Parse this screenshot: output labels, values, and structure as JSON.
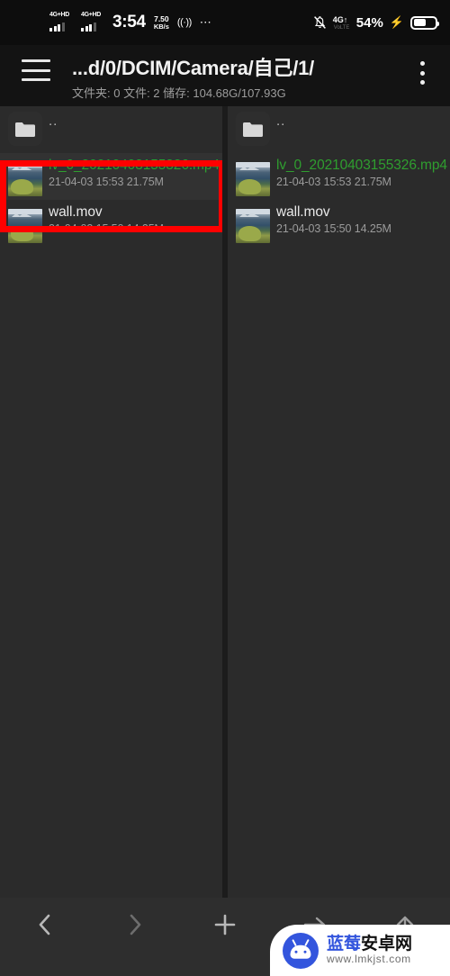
{
  "status_bar": {
    "sim1_network": "4G+HD",
    "sim2_network": "4G+HD",
    "time": "3:54",
    "speed_value": "7.50",
    "speed_unit": "KB/s",
    "hotspot_icon": "hotspot-icon",
    "more_icon": "more-dots-icon",
    "mute_icon": "bell-muted-icon",
    "data_network": "4G",
    "data_sub": "VoLTE",
    "battery_percent": "54%",
    "charging_icon": "lightning-bolt-icon",
    "battery_icon": "battery-icon"
  },
  "header": {
    "menu_icon": "hamburger-menu-icon",
    "path": "...d/0/DCIM/Camera/自己/1/",
    "stats": "文件夹: 0  文件: 2  储存: 104.68G/107.93G",
    "overflow_icon": "more-vertical-icon"
  },
  "panels": [
    {
      "id": "left-panel",
      "up_entry": {
        "icon": "folder-icon",
        "label": ".."
      },
      "files": [
        {
          "name": "lv_0_20210403155326.mp4",
          "meta": "21-04-03 15:53  21.75M",
          "selected": true,
          "color": "#2f9e2f",
          "thumb": "video-thumbnail"
        },
        {
          "name": "wall.mov",
          "meta": "21-04-03 15:50  14.25M",
          "selected": false,
          "color": "#e9e9e9",
          "thumb": "video-thumbnail"
        }
      ]
    },
    {
      "id": "right-panel",
      "up_entry": {
        "icon": "folder-icon",
        "label": ".."
      },
      "files": [
        {
          "name": "lv_0_20210403155326.mp4",
          "meta": "21-04-03 15:53  21.75M",
          "selected": false,
          "color": "#2f9e2f",
          "thumb": "video-thumbnail"
        },
        {
          "name": "wall.mov",
          "meta": "21-04-03 15:50  14.25M",
          "selected": false,
          "color": "#e9e9e9",
          "thumb": "video-thumbnail"
        }
      ]
    }
  ],
  "annotation": {
    "color": "#ff0000",
    "target": "lv_0_20210403155326.mp4"
  },
  "bottom_bar": {
    "buttons": [
      {
        "icon": "chevron-left-icon",
        "name": "back-button",
        "dim": false
      },
      {
        "icon": "chevron-right-icon",
        "name": "forward-button",
        "dim": true
      },
      {
        "icon": "plus-icon",
        "name": "add-button",
        "dim": false
      },
      {
        "icon": "arrow-right-icon",
        "name": "send-button",
        "dim": false
      },
      {
        "icon": "arrow-up-icon",
        "name": "parent-dir-button",
        "dim": false
      }
    ]
  },
  "watermark": {
    "logo": "android-robot-logo",
    "title_part1": "蓝莓",
    "title_part2": "安卓网",
    "url": "www.lmkjst.com"
  }
}
